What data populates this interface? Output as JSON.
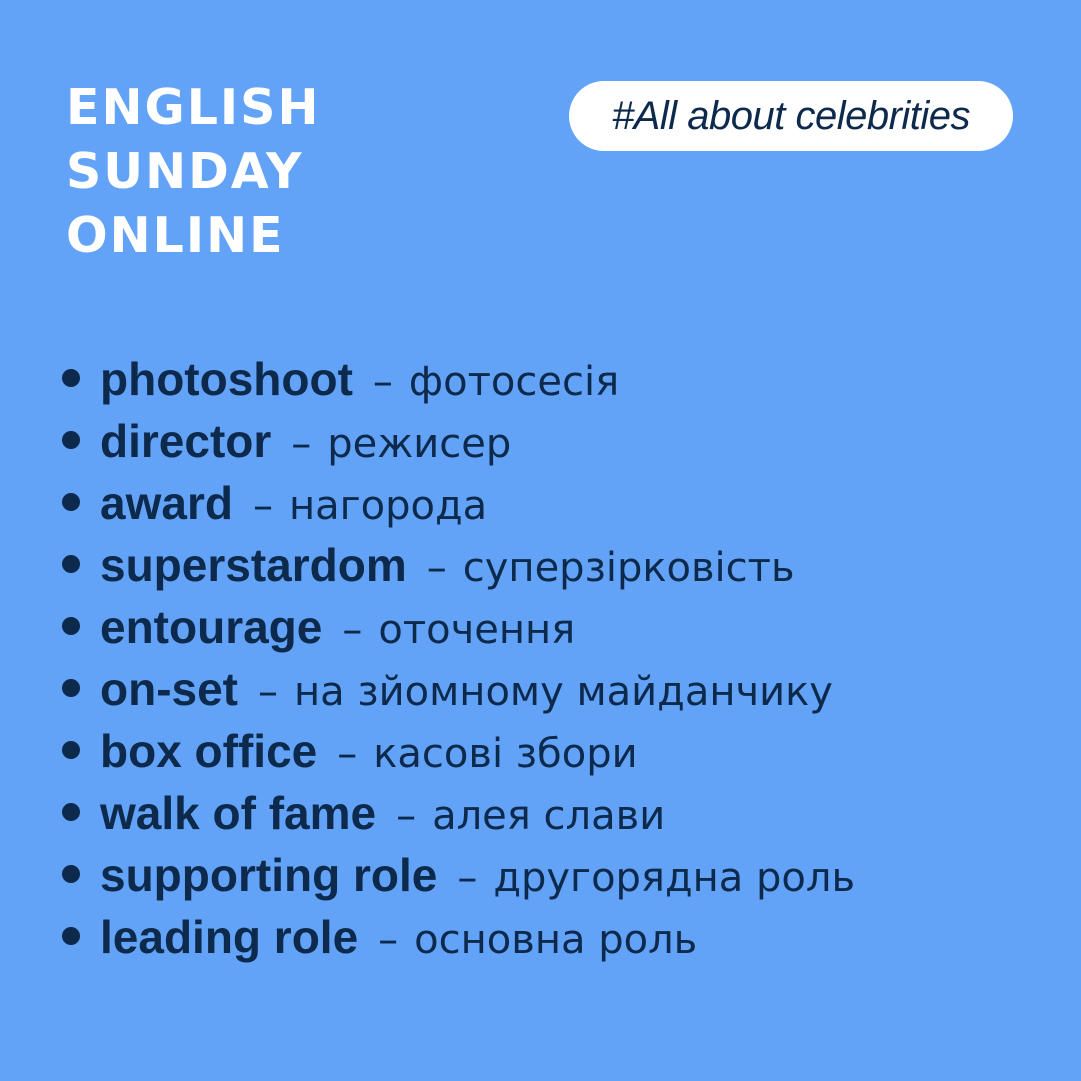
{
  "brand": {
    "lines": [
      "ENGLISH",
      "SUNDAY",
      "ONLINE"
    ]
  },
  "hashtag": "#All about celebrities",
  "separator": "–",
  "vocabulary": [
    {
      "term": "photoshoot",
      "translation": "фотосесія"
    },
    {
      "term": "director",
      "translation": "режисер"
    },
    {
      "term": "award",
      "translation": "нагорода"
    },
    {
      "term": "superstardom",
      "translation": "суперзірковість"
    },
    {
      "term": "entourage",
      "translation": "оточення"
    },
    {
      "term": "on-set",
      "translation": "на зйомному майданчику"
    },
    {
      "term": "box office",
      "translation": "касові збори"
    },
    {
      "term": "walk of fame",
      "translation": "алея слави"
    },
    {
      "term": "supporting role",
      "translation": "другорядна роль"
    },
    {
      "term": "leading role",
      "translation": "основна роль"
    }
  ],
  "colors": {
    "background": "#62a3f7",
    "text_dark": "#0d2a4c",
    "pill": "#ffffff"
  }
}
